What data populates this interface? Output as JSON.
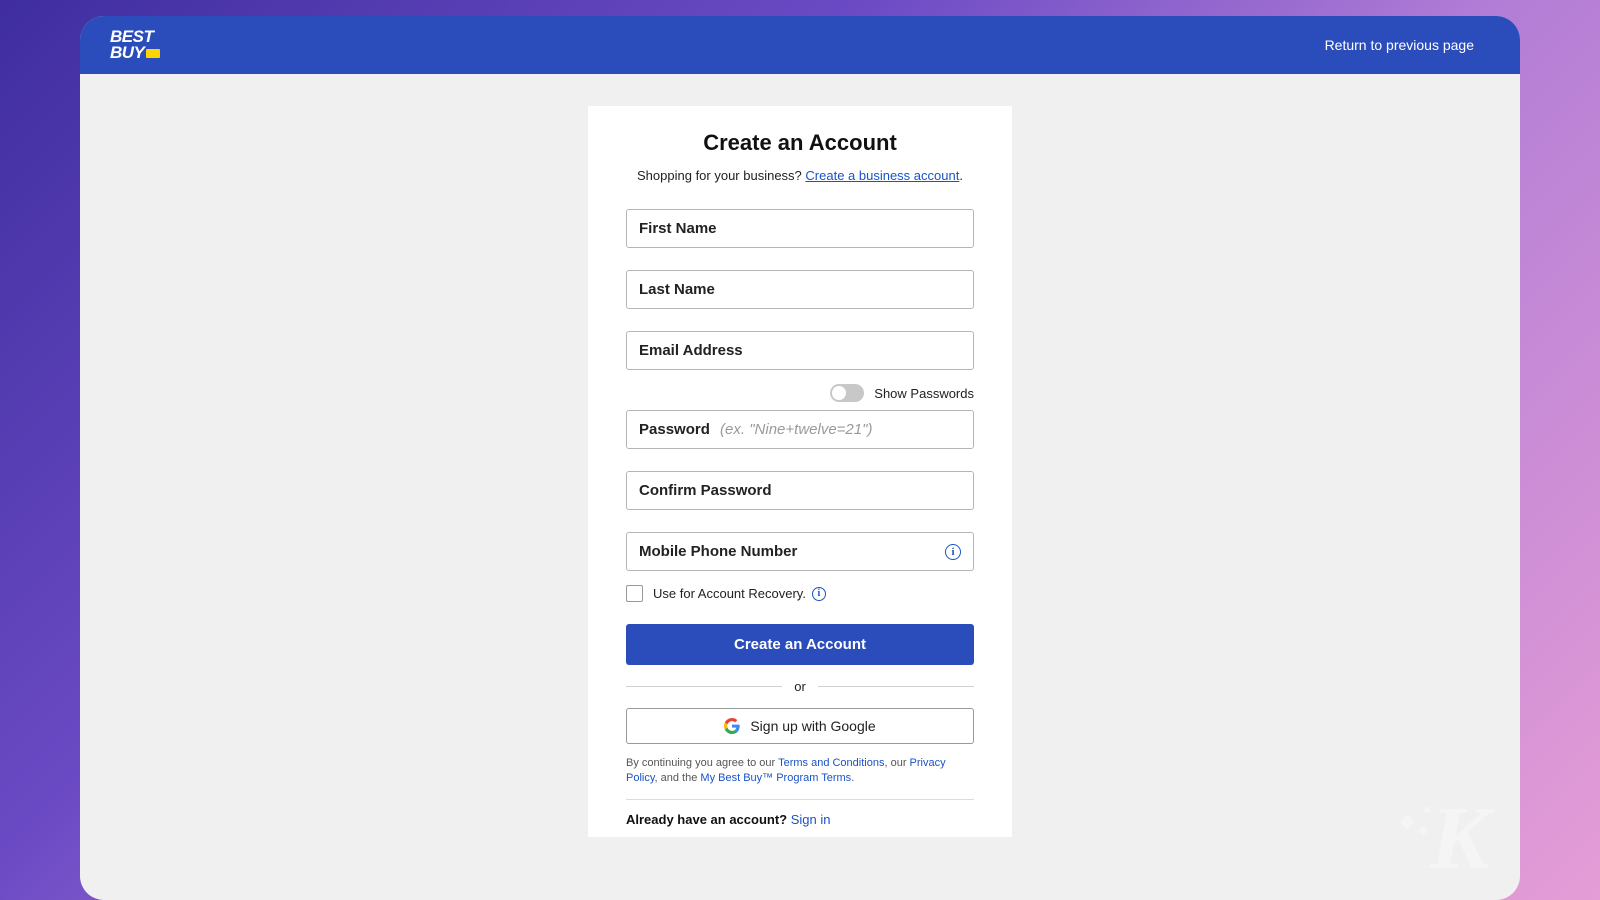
{
  "logo": {
    "line1": "BEST",
    "line2": "BUY"
  },
  "header": {
    "return_link": "Return to previous page"
  },
  "form": {
    "title": "Create an Account",
    "subtitle_prefix": "Shopping for your business? ",
    "subtitle_link": "Create a business account",
    "subtitle_suffix": ".",
    "first_name_label": "First Name",
    "last_name_label": "Last Name",
    "email_label": "Email Address",
    "show_passwords_label": "Show Passwords",
    "password_label": "Password",
    "password_hint": "(ex. \"Nine+twelve=21\")",
    "confirm_password_label": "Confirm Password",
    "mobile_label": "Mobile Phone Number",
    "recovery_label": "Use for Account Recovery.",
    "submit_label": "Create an Account",
    "or_label": "or",
    "google_label": "Sign up with Google"
  },
  "fineprint": {
    "p1": "By continuing you agree to our ",
    "l1": "Terms and Conditions",
    "p2": ", our ",
    "l2": "Privacy Policy",
    "p3": ", and the ",
    "l3": "My Best Buy™ Program Terms",
    "p4": "."
  },
  "already": {
    "text": "Already have an account? ",
    "link": "Sign in"
  }
}
